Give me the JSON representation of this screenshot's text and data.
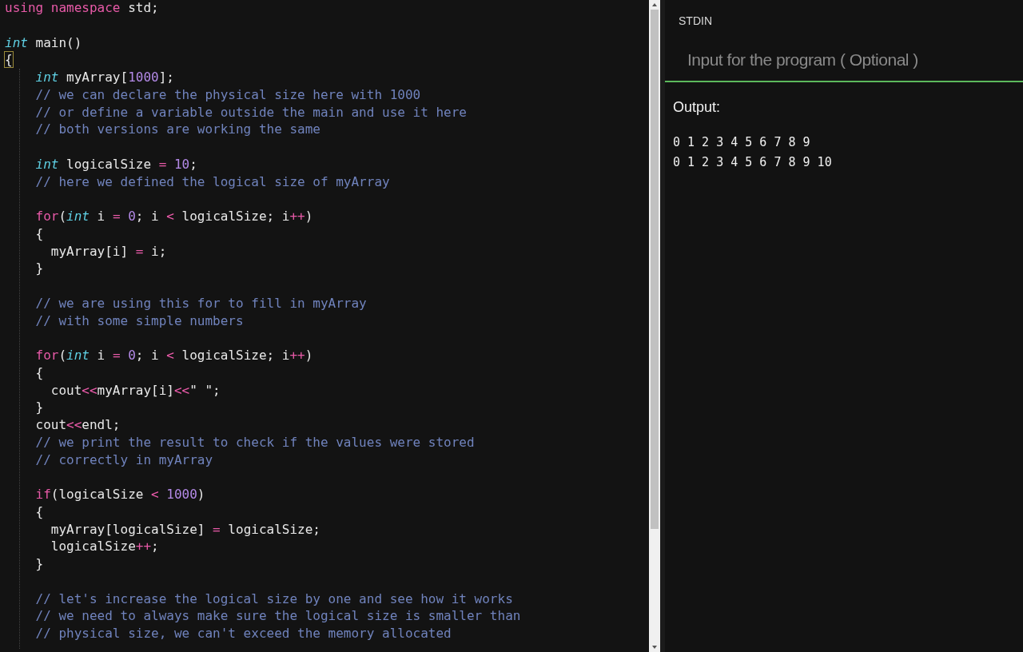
{
  "editor": {
    "lines": [
      {
        "kind": "code",
        "tokens": [
          {
            "kind": "keyword",
            "text": "using namespace"
          },
          {
            "kind": "plain",
            "text": " std;"
          }
        ]
      },
      {
        "kind": "blank"
      },
      {
        "kind": "code",
        "tokens": [
          {
            "kind": "type",
            "text": "int"
          },
          {
            "kind": "plain",
            "text": " main()"
          }
        ]
      },
      {
        "kind": "code",
        "tokens": [
          {
            "kind": "matched-bracket",
            "text": "{"
          }
        ]
      },
      {
        "kind": "code",
        "tokens": [
          {
            "kind": "type",
            "text": "    int"
          },
          {
            "kind": "plain",
            "text": " myArray["
          },
          {
            "kind": "number",
            "text": "1000"
          },
          {
            "kind": "plain",
            "text": "];"
          }
        ]
      },
      {
        "kind": "code",
        "tokens": [
          {
            "kind": "comment",
            "text": "    // we can declare the physical size here with 1000"
          }
        ]
      },
      {
        "kind": "code",
        "tokens": [
          {
            "kind": "comment",
            "text": "    // or define a variable outside the main and use it here"
          }
        ]
      },
      {
        "kind": "code",
        "tokens": [
          {
            "kind": "comment",
            "text": "    // both versions are working the same"
          }
        ]
      },
      {
        "kind": "blank"
      },
      {
        "kind": "code",
        "tokens": [
          {
            "kind": "type",
            "text": "    int"
          },
          {
            "kind": "plain",
            "text": " logicalSize "
          },
          {
            "kind": "operator",
            "text": "= "
          },
          {
            "kind": "number",
            "text": "10"
          },
          {
            "kind": "plain",
            "text": ";"
          }
        ]
      },
      {
        "kind": "code",
        "tokens": [
          {
            "kind": "comment",
            "text": "    // here we defined the logical size of myArray"
          }
        ]
      },
      {
        "kind": "blank"
      },
      {
        "kind": "code",
        "tokens": [
          {
            "kind": "keyword",
            "text": "    for"
          },
          {
            "kind": "plain",
            "text": "("
          },
          {
            "kind": "type",
            "text": "int"
          },
          {
            "kind": "plain",
            "text": " i "
          },
          {
            "kind": "operator",
            "text": "= "
          },
          {
            "kind": "number",
            "text": "0"
          },
          {
            "kind": "plain",
            "text": "; i "
          },
          {
            "kind": "operator",
            "text": "<"
          },
          {
            "kind": "plain",
            "text": " logicalSize; i"
          },
          {
            "kind": "operator",
            "text": "++"
          },
          {
            "kind": "plain",
            "text": ")"
          }
        ]
      },
      {
        "kind": "code",
        "tokens": [
          {
            "kind": "plain",
            "text": "    {"
          }
        ]
      },
      {
        "kind": "code",
        "tokens": [
          {
            "kind": "plain",
            "text": "      myArray[i] "
          },
          {
            "kind": "operator",
            "text": "="
          },
          {
            "kind": "plain",
            "text": " i;"
          }
        ]
      },
      {
        "kind": "code",
        "tokens": [
          {
            "kind": "plain",
            "text": "    }"
          }
        ]
      },
      {
        "kind": "blank"
      },
      {
        "kind": "code",
        "tokens": [
          {
            "kind": "comment",
            "text": "    // we are using this for to fill in myArray"
          }
        ]
      },
      {
        "kind": "code",
        "tokens": [
          {
            "kind": "comment",
            "text": "    // with some simple numbers"
          }
        ]
      },
      {
        "kind": "blank"
      },
      {
        "kind": "code",
        "tokens": [
          {
            "kind": "keyword",
            "text": "    for"
          },
          {
            "kind": "plain",
            "text": "("
          },
          {
            "kind": "type",
            "text": "int"
          },
          {
            "kind": "plain",
            "text": " i "
          },
          {
            "kind": "operator",
            "text": "= "
          },
          {
            "kind": "number",
            "text": "0"
          },
          {
            "kind": "plain",
            "text": "; i "
          },
          {
            "kind": "operator",
            "text": "<"
          },
          {
            "kind": "plain",
            "text": " logicalSize; i"
          },
          {
            "kind": "operator",
            "text": "++"
          },
          {
            "kind": "plain",
            "text": ")"
          }
        ]
      },
      {
        "kind": "code",
        "tokens": [
          {
            "kind": "plain",
            "text": "    {"
          }
        ]
      },
      {
        "kind": "code",
        "tokens": [
          {
            "kind": "plain",
            "text": "      cout"
          },
          {
            "kind": "operator",
            "text": "<<"
          },
          {
            "kind": "plain",
            "text": "myArray[i]"
          },
          {
            "kind": "operator",
            "text": "<<"
          },
          {
            "kind": "plain",
            "text": "\" \";"
          }
        ]
      },
      {
        "kind": "code",
        "tokens": [
          {
            "kind": "plain",
            "text": "    }"
          }
        ]
      },
      {
        "kind": "code",
        "tokens": [
          {
            "kind": "plain",
            "text": "    cout"
          },
          {
            "kind": "operator",
            "text": "<<"
          },
          {
            "kind": "plain",
            "text": "endl;"
          }
        ]
      },
      {
        "kind": "code",
        "tokens": [
          {
            "kind": "comment",
            "text": "    // we print the result to check if the values were stored"
          }
        ]
      },
      {
        "kind": "code",
        "tokens": [
          {
            "kind": "comment",
            "text": "    // correctly in myArray"
          }
        ]
      },
      {
        "kind": "blank"
      },
      {
        "kind": "code",
        "tokens": [
          {
            "kind": "keyword",
            "text": "    if"
          },
          {
            "kind": "plain",
            "text": "(logicalSize "
          },
          {
            "kind": "operator",
            "text": "< "
          },
          {
            "kind": "number",
            "text": "1000"
          },
          {
            "kind": "plain",
            "text": ")"
          }
        ]
      },
      {
        "kind": "code",
        "tokens": [
          {
            "kind": "plain",
            "text": "    {"
          }
        ]
      },
      {
        "kind": "code",
        "tokens": [
          {
            "kind": "plain",
            "text": "      myArray[logicalSize] "
          },
          {
            "kind": "operator",
            "text": "="
          },
          {
            "kind": "plain",
            "text": " logicalSize;"
          }
        ]
      },
      {
        "kind": "code",
        "tokens": [
          {
            "kind": "plain",
            "text": "      logicalSize"
          },
          {
            "kind": "operator",
            "text": "++"
          },
          {
            "kind": "plain",
            "text": ";"
          }
        ]
      },
      {
        "kind": "code",
        "tokens": [
          {
            "kind": "plain",
            "text": "    }"
          }
        ]
      },
      {
        "kind": "blank"
      },
      {
        "kind": "code",
        "tokens": [
          {
            "kind": "comment",
            "text": "    // let's increase the logical size by one and see how it works"
          }
        ]
      },
      {
        "kind": "code",
        "tokens": [
          {
            "kind": "comment",
            "text": "    // we need to always make sure the logical size is smaller than"
          }
        ]
      },
      {
        "kind": "code",
        "tokens": [
          {
            "kind": "comment",
            "text": "    // physical size, we can't exceed the memory allocated"
          }
        ]
      }
    ]
  },
  "stdin": {
    "label": "STDIN",
    "placeholder": "Input for the program ( Optional )"
  },
  "output": {
    "label": "Output:",
    "lines": [
      "0 1 2 3 4 5 6 7 8 9",
      "0 1 2 3 4 5 6 7 8 9 10"
    ]
  }
}
